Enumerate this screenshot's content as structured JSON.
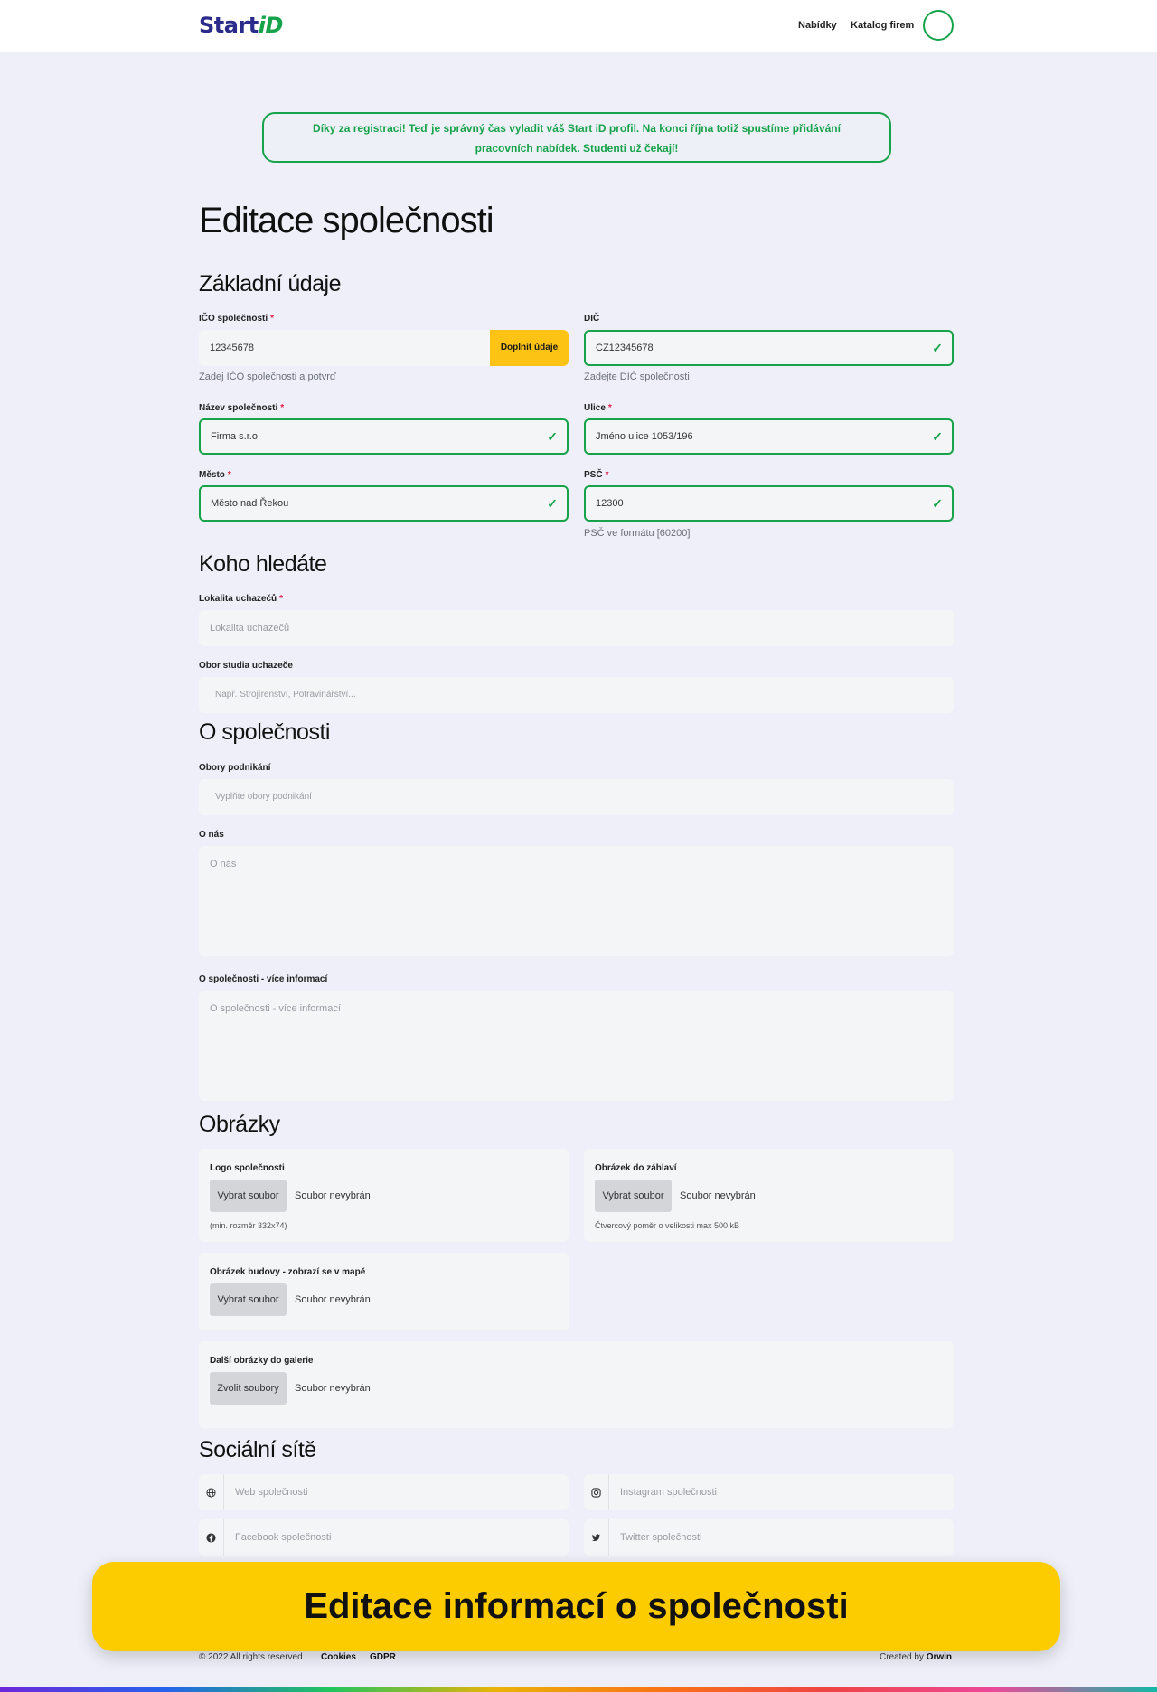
{
  "header": {
    "logo_start": "Start",
    "logo_id": "iD",
    "nav": [
      "Nabídky",
      "Katalog firem"
    ]
  },
  "notice": "Díky za registraci! Teď je správný čas vyladit váš Start iD profil. Na konci října totiž spustíme přidávání pracovních nabídek. Studenti už čekají!",
  "page_title": "Editace společnosti",
  "basic": {
    "title": "Základní údaje",
    "ico": {
      "label": "IČO společnosti",
      "value": "12345678",
      "button": "Doplnit údaje",
      "hint": "Zadej IČO společnosti a potvrď"
    },
    "dic": {
      "label": "DIČ",
      "value": "CZ12345678",
      "hint": "Zadejte DIČ společnosti"
    },
    "name": {
      "label": "Název společnosti",
      "value": "Firma s.r.o."
    },
    "street": {
      "label": "Ulice",
      "value": "Jméno ulice 1053/196"
    },
    "city": {
      "label": "Město",
      "value": "Město nad Řekou"
    },
    "zip": {
      "label": "PSČ",
      "value": "12300",
      "hint": "PSČ ve formátu [60200]"
    }
  },
  "seeking": {
    "title": "Koho hledáte",
    "location": {
      "label": "Lokalita uchazečů",
      "placeholder": "Lokalita uchazečů"
    },
    "field_of_study": {
      "label": "Obor studia uchazeče",
      "placeholder": "Např. Strojírenství, Potravinářství..."
    }
  },
  "about": {
    "title": "O společnosti",
    "business": {
      "label": "Obory podnikání",
      "placeholder": "Vyplňte obory podnikání"
    },
    "about_us": {
      "label": "O nás",
      "placeholder": "O nás"
    },
    "more": {
      "label": "O společnosti - více informací",
      "placeholder": "O společnosti - více informací"
    }
  },
  "images": {
    "title": "Obrázky",
    "logo": {
      "label": "Logo společnosti",
      "button": "Vybrat soubor",
      "status": "Soubor nevybrán",
      "hint": "(min. rozměr 332x74)"
    },
    "header": {
      "label": "Obrázek do záhlaví",
      "button": "Vybrat soubor",
      "status": "Soubor nevybrán",
      "hint": "Čtvercový poměr o velikosti max 500 kB"
    },
    "building": {
      "label": "Obrázek budovy - zobrazí se v mapě",
      "button": "Vybrat soubor",
      "status": "Soubor nevybrán"
    },
    "gallery": {
      "label": "Další obrázky do galerie",
      "button": "Zvolit soubory",
      "status": "Soubor nevybrán"
    }
  },
  "social": {
    "title": "Sociální sítě",
    "web": {
      "icon": "globe-icon",
      "placeholder": "Web společnosti"
    },
    "instagram": {
      "icon": "instagram-icon",
      "placeholder": "Instagram společnosti"
    },
    "facebook": {
      "icon": "facebook-icon",
      "placeholder": "Facebook společnosti"
    },
    "twitter": {
      "icon": "twitter-icon",
      "placeholder": "Twitter společnosti"
    }
  },
  "banner": "Editace informací o společnosti",
  "footer": {
    "copyright": "© 2022 All rights reserved",
    "cookies": "Cookies",
    "gdpr": "GDPR",
    "created_by": "Created by",
    "author": "Orwin"
  },
  "colors": {
    "accent_green": "#17a34a",
    "brand_blue": "#2b2b8c",
    "yellow": "#fcc314",
    "banner_yellow": "#fccb00",
    "required": "#e11d48"
  }
}
